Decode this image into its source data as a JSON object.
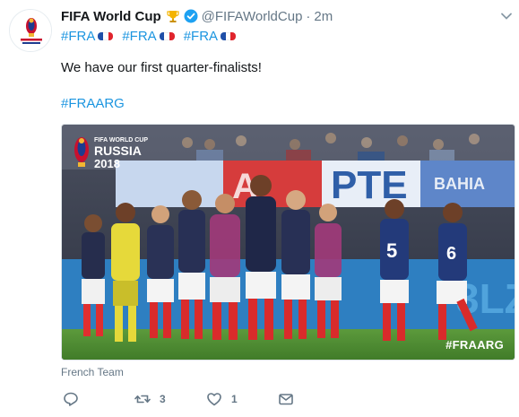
{
  "tweet": {
    "author_name": "FIFA World Cup",
    "trophy_icon": "trophy-emoji",
    "verified_icon": "verified-badge-icon",
    "handle": "@FIFAWorldCup",
    "separator": "·",
    "timestamp": "2m",
    "hashtags": [
      "#FRA",
      "#FRA",
      "#FRA"
    ],
    "flag_colors": [
      "#1f4fa8",
      "#ffffff",
      "#e0242d"
    ],
    "text": "We have our first quarter-finalists!",
    "link_hashtag": "#FRAARG",
    "media": {
      "logo_line1": "FIFA WORLD CUP",
      "logo_line2": "RUSSIA",
      "logo_line3": "2018",
      "watermark": "#FRAARG"
    },
    "media_caption": "French Team",
    "actions": {
      "reply_icon": "reply-icon",
      "retweet_icon": "retweet-icon",
      "retweet_count": "3",
      "like_icon": "heart-icon",
      "like_count": "1",
      "message_icon": "envelope-icon"
    }
  },
  "colors": {
    "accent_link": "#1b95e0",
    "text_primary": "#14171a",
    "text_secondary": "#657786",
    "verified": "#1da1f2"
  }
}
